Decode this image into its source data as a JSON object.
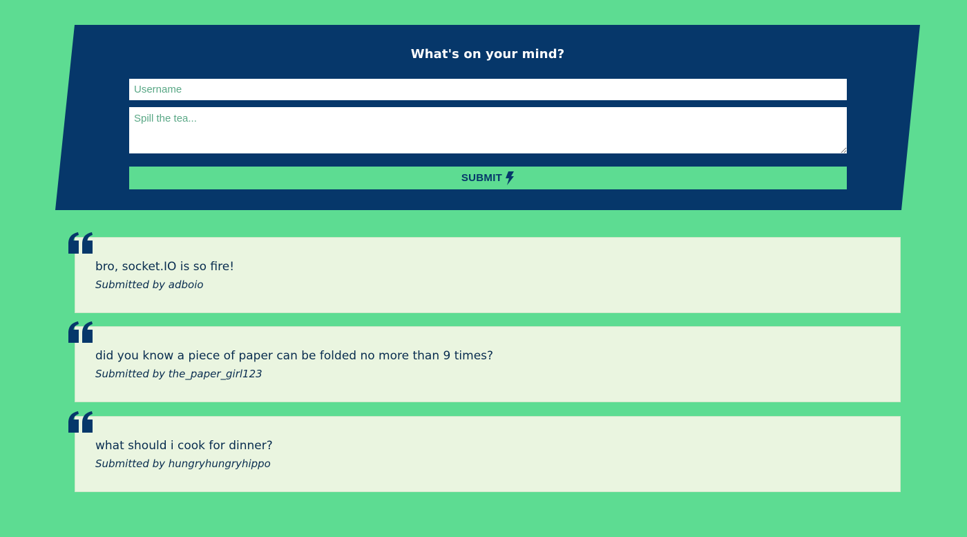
{
  "colors": {
    "background": "#5ddc92",
    "panel": "#06376a",
    "card": "#eaf5e0",
    "text": "#072b4e"
  },
  "form": {
    "title": "What's on your mind?",
    "username_placeholder": "Username",
    "username_value": "",
    "message_placeholder": "Spill the tea...",
    "message_value": "",
    "submit_label": "SUBMIT",
    "submit_icon": "bolt-icon"
  },
  "posts": [
    {
      "icon": "quote-icon",
      "message": "bro, socket.IO is so fire!",
      "author_line": "Submitted by adboio"
    },
    {
      "icon": "quote-icon",
      "message": "did you know a piece of paper can be folded no more than 9 times?",
      "author_line": "Submitted by the_paper_girl123"
    },
    {
      "icon": "quote-icon",
      "message": "what should i cook for dinner?",
      "author_line": "Submitted by hungryhungryhippo"
    }
  ]
}
